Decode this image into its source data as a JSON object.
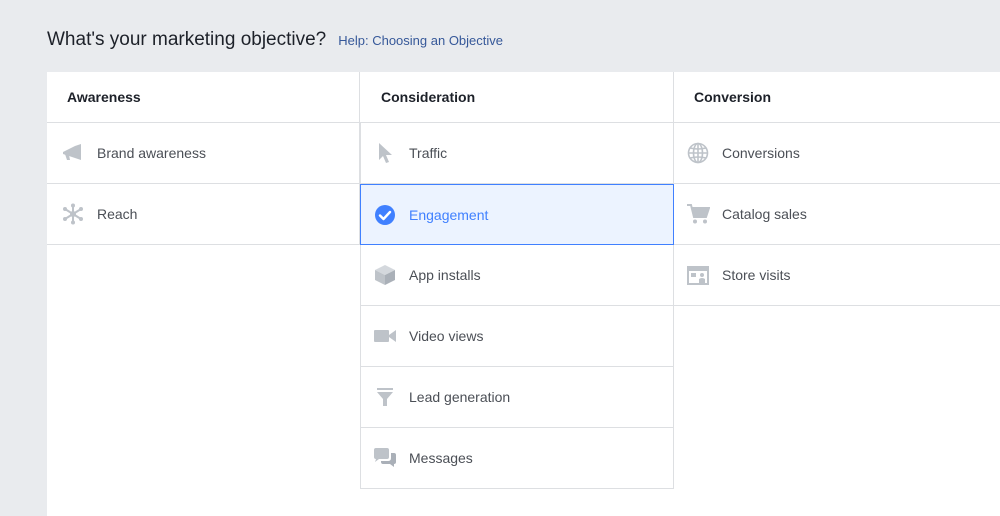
{
  "header": {
    "title": "What's your marketing objective?",
    "help_link": "Help: Choosing an Objective"
  },
  "columns": {
    "awareness": {
      "title": "Awareness",
      "items": [
        {
          "label": "Brand awareness",
          "icon": "megaphone-icon"
        },
        {
          "label": "Reach",
          "icon": "reach-icon"
        }
      ]
    },
    "consideration": {
      "title": "Consideration",
      "items": [
        {
          "label": "Traffic",
          "icon": "cursor-icon"
        },
        {
          "label": "Engagement",
          "icon": "checkmark-circle-icon",
          "selected": true
        },
        {
          "label": "App installs",
          "icon": "box-icon"
        },
        {
          "label": "Video views",
          "icon": "video-camera-icon"
        },
        {
          "label": "Lead generation",
          "icon": "funnel-icon"
        },
        {
          "label": "Messages",
          "icon": "chat-bubbles-icon"
        }
      ]
    },
    "conversion": {
      "title": "Conversion",
      "items": [
        {
          "label": "Conversions",
          "icon": "globe-icon"
        },
        {
          "label": "Catalog sales",
          "icon": "shopping-cart-icon"
        },
        {
          "label": "Store visits",
          "icon": "storefront-icon"
        }
      ]
    }
  },
  "colors": {
    "background": "#e9ebee",
    "panel": "#ffffff",
    "icon_gray": "#bec3c9",
    "selected_blue": "#4080ff",
    "selected_bg": "#ecf3ff",
    "link": "#365899"
  }
}
